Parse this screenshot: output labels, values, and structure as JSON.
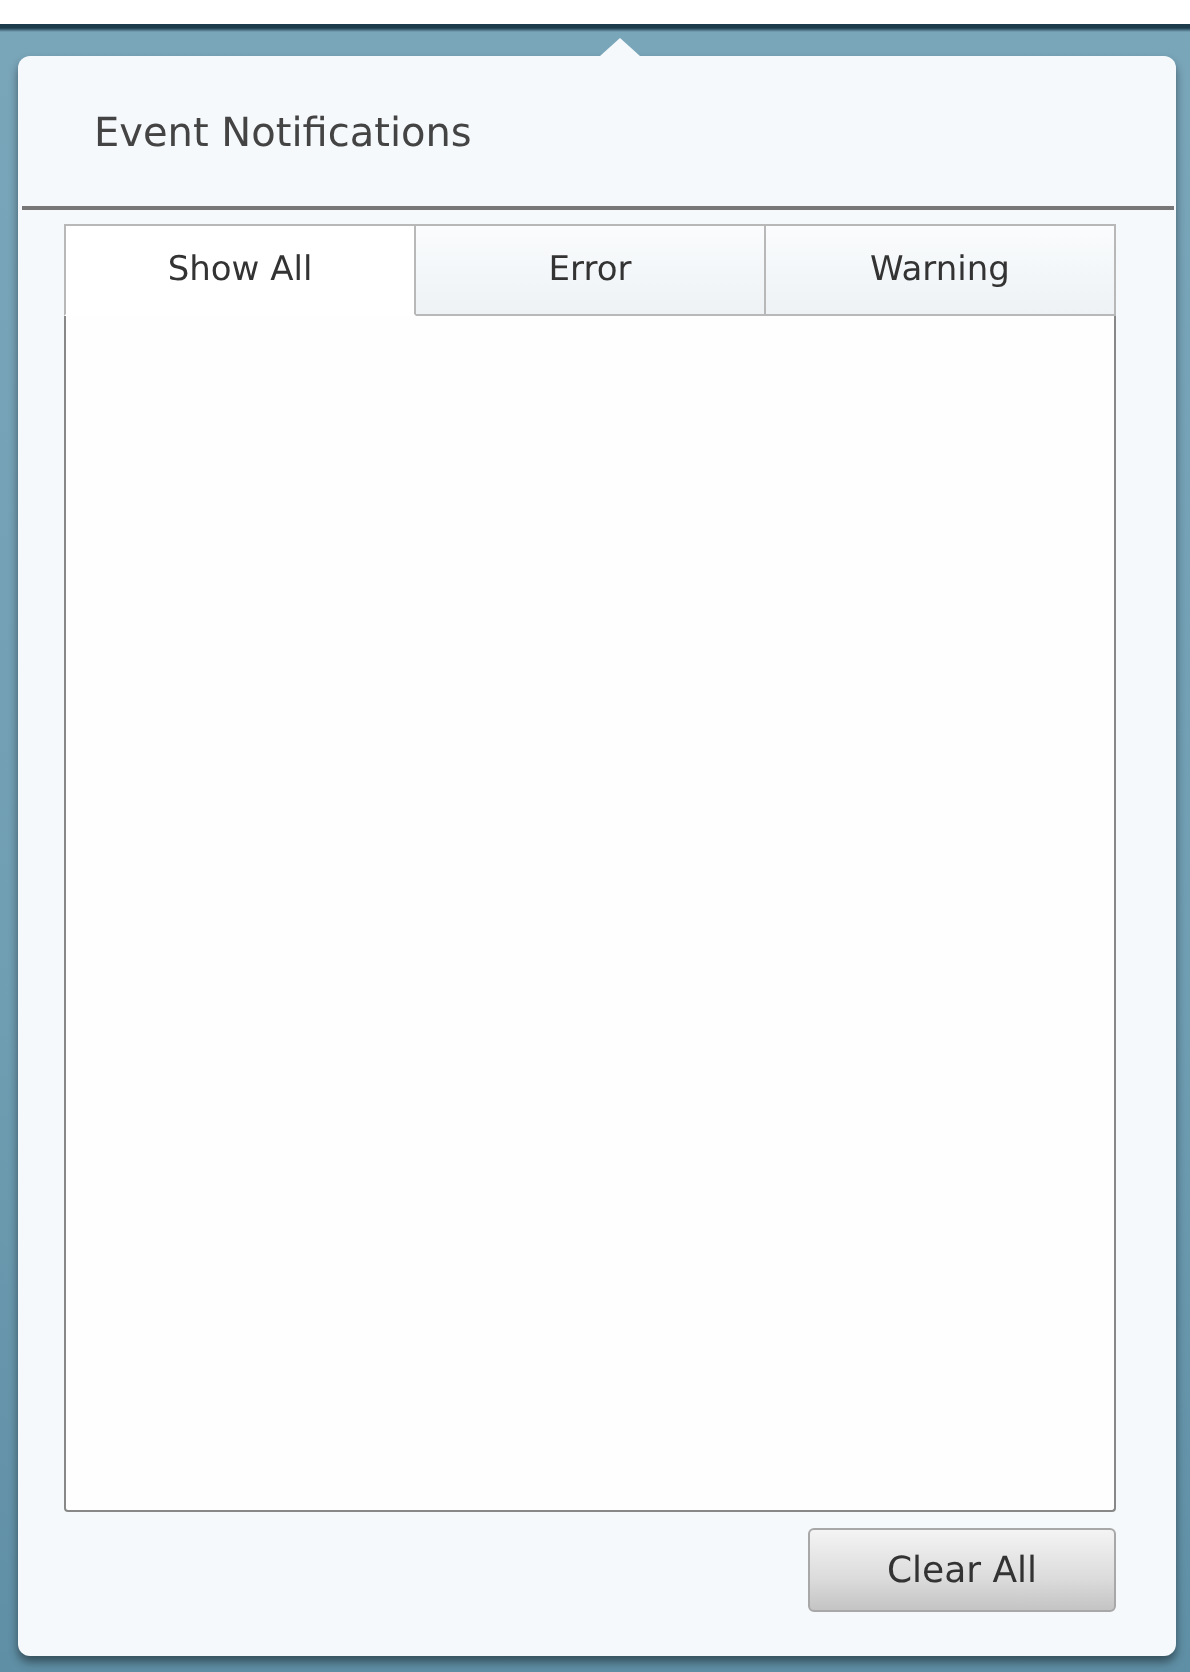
{
  "panel": {
    "title": "Event Notifications"
  },
  "tabs": [
    {
      "label": "Show All",
      "selected": true
    },
    {
      "label": "Error",
      "selected": false
    },
    {
      "label": "Warning",
      "selected": false
    }
  ],
  "buttons": [
    "Clear All"
  ]
}
